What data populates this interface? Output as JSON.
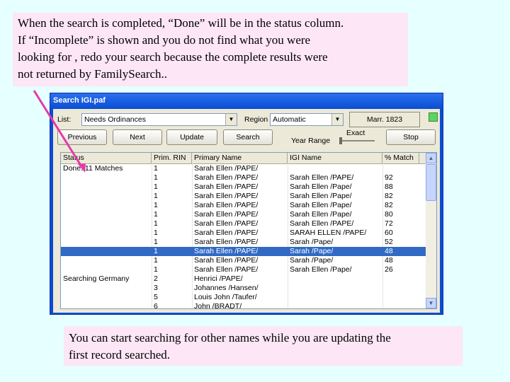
{
  "note_top": {
    "lines": [
      "When the search is completed, “Done” will be in the status column.",
      "If “Incomplete” is shown and you do not find what you were",
      "looking for , redo your search because the complete results were",
      "not returned by FamilySearch.."
    ]
  },
  "note_bottom": {
    "lines": [
      "You can start searching for other names while you are updating the",
      "first record searched."
    ]
  },
  "window": {
    "title": "Search IGI.paf",
    "list_label": "List:",
    "list_value": "Needs Ordinances",
    "region_label": "Region",
    "region_value": "Automatic",
    "marr_value": "Marr. 1823",
    "buttons": {
      "previous": "Previous",
      "next": "Next",
      "update": "Update",
      "search": "Search",
      "stop": "Stop"
    },
    "year_range_label": "Year Range",
    "exact_label": "Exact",
    "columns": [
      "Status",
      "Prim. RIN",
      "Primary Name",
      "IGI Name",
      "% Match"
    ],
    "rows": [
      [
        "Done: 11 Matches",
        "1",
        "Sarah Ellen /PAPE/",
        "",
        ""
      ],
      [
        "",
        "1",
        "Sarah Ellen /PAPE/",
        "Sarah Ellen /PAPE/",
        "92"
      ],
      [
        "",
        "1",
        "Sarah Ellen /PAPE/",
        "Sarah Ellen /Pape/",
        "88"
      ],
      [
        "",
        "1",
        "Sarah Ellen /PAPE/",
        "Sarah Ellen /Pape/",
        "82"
      ],
      [
        "",
        "1",
        "Sarah Ellen /PAPE/",
        "Sarah Ellen /Pape/",
        "82"
      ],
      [
        "",
        "1",
        "Sarah Ellen /PAPE/",
        "Sarah Ellen /Pape/",
        "80"
      ],
      [
        "",
        "1",
        "Sarah Ellen /PAPE/",
        "Sarah Ellen /PAPE/",
        "72"
      ],
      [
        "",
        "1",
        "Sarah Ellen /PAPE/",
        "SARAH ELLEN /PAPE/",
        "60"
      ],
      [
        "",
        "1",
        "Sarah Ellen /PAPE/",
        "Sarah /Pape/",
        "52"
      ],
      [
        "",
        "1",
        "Sarah Ellen /PAPE/",
        "Sarah /Pape/",
        "48"
      ],
      [
        "",
        "1",
        "Sarah Ellen /PAPE/",
        "Sarah /Pape/",
        "48"
      ],
      [
        "",
        "1",
        "Sarah Ellen /PAPE/",
        "Sarah Ellen /Pape/",
        "26"
      ],
      [
        "Searching Germany",
        "2",
        "Henrici /PAPE/",
        "",
        ""
      ],
      [
        "",
        "3",
        "Johannes /Hansen/",
        "",
        ""
      ],
      [
        "",
        "5",
        "Louis John /Taufer/",
        "",
        ""
      ],
      [
        "",
        "6",
        "John /BRADT/",
        "",
        ""
      ]
    ],
    "selected_row": 9
  },
  "colors": {
    "note_bg": "#fde6f6",
    "page_bg": "#e6ffff",
    "arrow": "#e63aa8",
    "selection": "#316ac5"
  }
}
